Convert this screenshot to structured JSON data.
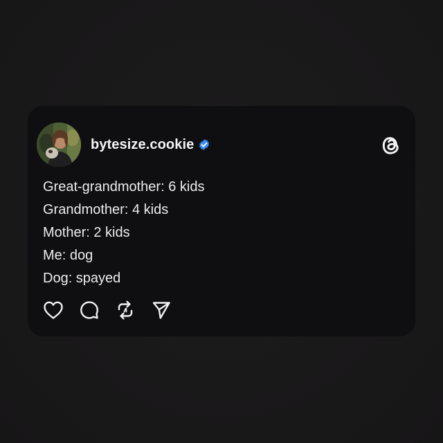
{
  "post": {
    "username": "bytesize.cookie",
    "verified": true,
    "lines": [
      "Great-grandmother: 6 kids",
      "Grandmother: 4 kids",
      "Mother: 2 kids",
      "Me: dog",
      "Dog: spayed"
    ],
    "brand_logo": "threads-logo-icon",
    "actions": [
      "heart-icon",
      "comment-icon",
      "repost-icon",
      "share-icon"
    ]
  },
  "colors": {
    "background": "#1b1a1b",
    "card": "#0f0e10",
    "text": "#ededed",
    "verified_badge": "#3b8cf0"
  }
}
